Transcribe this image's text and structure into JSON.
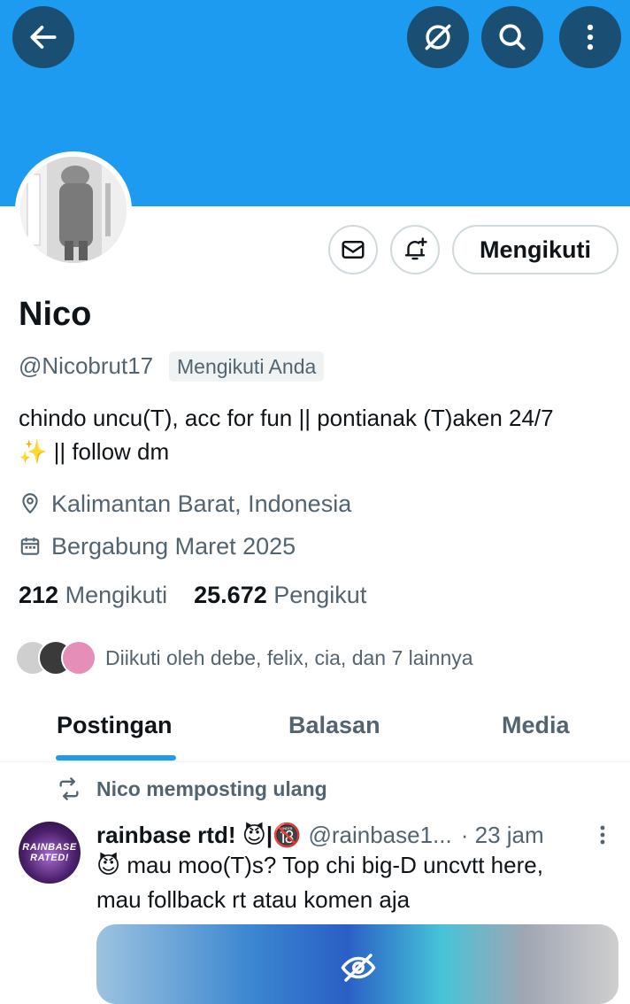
{
  "header": {
    "back_icon": "arrow-left-icon",
    "grok_icon": "grok-icon",
    "search_icon": "search-icon",
    "more_icon": "more-vertical-icon",
    "banner_color": "#1d9bf0"
  },
  "profile": {
    "name": "Nico",
    "handle": "@Nicobrut17",
    "follows_you": "Mengikuti Anda",
    "bio_line1": "chindo uncu(T), acc for fun  || pontianak (T)aken 24/7",
    "bio_line2": "✨ || follow dm",
    "location": "Kalimantan Barat, Indonesia",
    "joined": "Bergabung Maret 2025",
    "following_count": "212",
    "following_label": "Mengikuti",
    "followers_count": "25.672",
    "followers_label": "Pengikut",
    "followed_by": "Diikuti oleh debe, felix, cia, dan 7 lainnya"
  },
  "actions": {
    "message_icon": "mail-icon",
    "notify_icon": "bell-plus-icon",
    "follow_label": "Mengikuti"
  },
  "tabs": [
    {
      "label": "Postingan",
      "active": true
    },
    {
      "label": "Balasan",
      "active": false
    },
    {
      "label": "Media",
      "active": false
    }
  ],
  "post": {
    "repost_label": "Nico memposting ulang",
    "author_name": "rainbase rtd! 😈|🔞",
    "author_handle": "@rainbase1...",
    "time": "· 23 jam",
    "avatar_text": "RAINBASE RATED!",
    "text_line1": "😈 mau moo(T)s? Top chi big-D uncvtt here,",
    "text_line2": "mau follback rt atau komen aja"
  },
  "colors": {
    "accent": "#1d9bf0",
    "text": "#0f1419",
    "secondary": "#536471"
  }
}
